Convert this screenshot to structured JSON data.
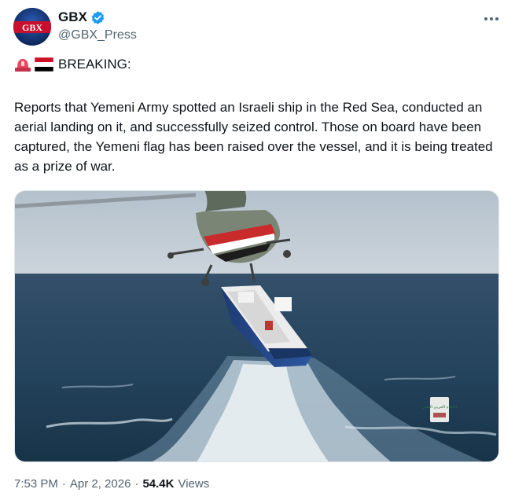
{
  "author": {
    "display_name": "GBX",
    "handle": "@GBX_Press",
    "avatar_text": "GBX",
    "verified": true,
    "verified_color": "#1d9bf0"
  },
  "post": {
    "headline": "BREAKING:",
    "headline_emoji": [
      "rotating-light",
      "yemen-flag"
    ],
    "body": "Reports that Yemeni Army spotted an Israeli ship in the Red Sea, conducted an aerial landing on it, and successfully seized control. Those on board have been captured, the Yemeni flag has been raised over the vessel, and it is being treated as a prize of war.",
    "media": {
      "description_icon": "photo",
      "watermark_text": "الإعلام الحربي اليمني"
    }
  },
  "meta": {
    "time": "7:53 PM",
    "separator": "·",
    "date": "Apr 2, 2026",
    "views_count": "54.4K",
    "views_label": "Views"
  },
  "colors": {
    "text_primary": "#0f1419",
    "text_secondary": "#536471",
    "accent": "#1d9bf0"
  }
}
